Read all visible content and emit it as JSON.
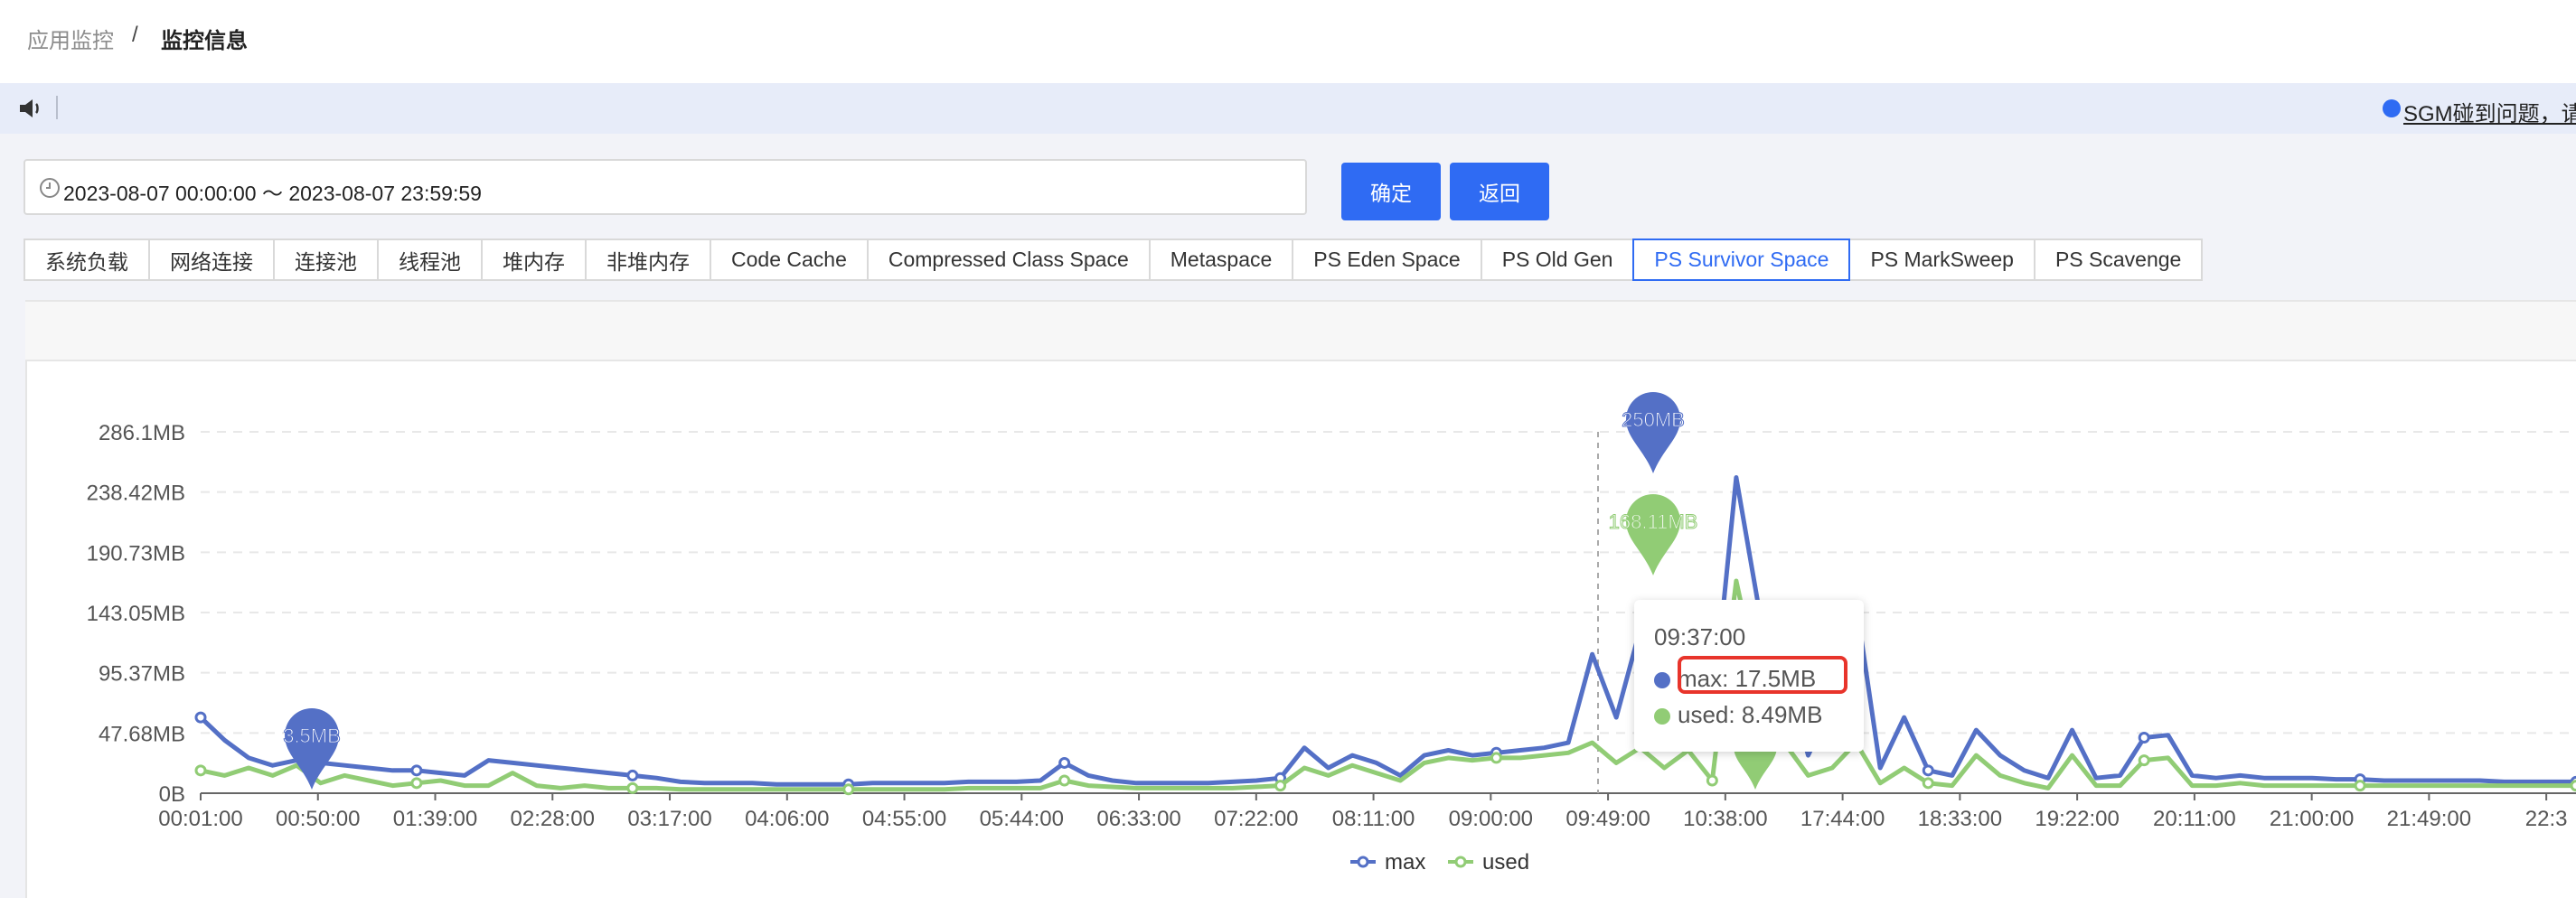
{
  "breadcrumb": {
    "root": "应用监控",
    "separator": "/",
    "current": "监控信息"
  },
  "notice": {
    "text": "SGM碰到问题，请",
    "icon": "speaker-icon",
    "dot_color": "#2f6bf3"
  },
  "date_range": {
    "value": "2023-08-07 00:00:00 ～ 2023-08-07 23:59:59",
    "icon": "clock-icon"
  },
  "buttons": {
    "confirm": "确定",
    "back": "返回"
  },
  "tabs": [
    "系统负载",
    "网络连接",
    "连接池",
    "线程池",
    "堆内存",
    "非堆内存",
    "Code Cache",
    "Compressed Class Space",
    "Metaspace",
    "PS Eden Space",
    "PS Old Gen",
    "PS Survivor Space",
    "PS MarkSweep",
    "PS Scavenge"
  ],
  "active_tab": "PS Survivor Space",
  "colors": {
    "accent": "#2f6bf3",
    "max": "#5470c6",
    "used": "#91cc75",
    "highlight": "#e8342b"
  },
  "chart_data": {
    "type": "line",
    "y_ticks": [
      "0B",
      "47.68MB",
      "95.37MB",
      "143.05MB",
      "190.73MB",
      "238.42MB",
      "286.1MB"
    ],
    "ylim": [
      0,
      286.1
    ],
    "x_ticks": [
      "00:01:00",
      "00:50:00",
      "01:39:00",
      "02:28:00",
      "03:17:00",
      "04:06:00",
      "04:55:00",
      "05:44:00",
      "06:33:00",
      "07:22:00",
      "08:11:00",
      "09:00:00",
      "09:49:00",
      "10:38:00",
      "17:44:00",
      "18:33:00",
      "19:22:00",
      "20:11:00",
      "21:00:00",
      "21:49:00",
      "22:3"
    ],
    "series": [
      {
        "name": "max",
        "color": "#5470c6",
        "values": [
          60,
          42,
          28,
          22,
          26,
          24,
          22,
          20,
          18,
          18,
          16,
          14,
          26,
          24,
          22,
          20,
          18,
          16,
          14,
          12,
          9,
          8,
          8,
          8,
          7,
          7,
          7,
          7,
          8,
          8,
          8,
          8,
          9,
          9,
          9,
          10,
          24,
          14,
          10,
          8,
          8,
          8,
          8,
          9,
          10,
          12,
          36,
          20,
          30,
          24,
          14,
          30,
          34,
          30,
          32,
          34,
          36,
          40,
          110,
          60,
          130,
          40,
          120,
          60,
          250,
          140,
          100,
          30,
          70,
          150,
          20,
          60,
          18,
          14,
          50,
          30,
          18,
          12,
          50,
          12,
          14,
          44,
          46,
          14,
          12,
          14,
          12,
          12,
          12,
          11,
          11,
          10,
          10,
          10,
          10,
          10,
          9,
          9,
          9,
          9
        ],
        "pin_labels": [
          "3.5MB",
          "250MB"
        ]
      },
      {
        "name": "used",
        "color": "#91cc75",
        "values": [
          18,
          14,
          20,
          14,
          22,
          8,
          14,
          10,
          6,
          8,
          10,
          6,
          6,
          16,
          6,
          4,
          6,
          4,
          4,
          4,
          3,
          3,
          3,
          3,
          3,
          3,
          3,
          3,
          3,
          3,
          3,
          3,
          4,
          4,
          4,
          4,
          10,
          6,
          5,
          4,
          4,
          4,
          4,
          4,
          5,
          6,
          20,
          14,
          22,
          16,
          10,
          24,
          28,
          26,
          28,
          28,
          30,
          32,
          40,
          24,
          36,
          20,
          34,
          10,
          168.11,
          80,
          40,
          14,
          20,
          40,
          8,
          20,
          8,
          6,
          30,
          14,
          8,
          4,
          30,
          6,
          6,
          26,
          28,
          6,
          6,
          8,
          6,
          6,
          6,
          6,
          6,
          6,
          6,
          6,
          6,
          6,
          6,
          6,
          6,
          6
        ],
        "pin_labels": [
          "168.11MB"
        ]
      }
    ],
    "tooltip": {
      "time": "09:37:00",
      "max": "max: 17.5MB",
      "used": "used: 8.49MB"
    },
    "legend": {
      "max": "max",
      "used": "used"
    }
  }
}
